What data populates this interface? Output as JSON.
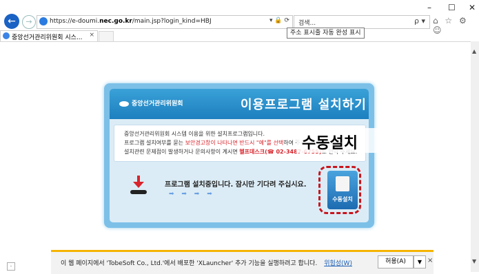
{
  "window": {
    "minimize_icon": "minimize-icon",
    "maximize_icon": "maximize-icon",
    "close_icon": "close-icon",
    "minimize": "–",
    "maximize": "☐",
    "close": "✕"
  },
  "nav": {
    "back": "←",
    "forward": "→"
  },
  "address_bar": {
    "url_prefix": "https://e-doumi.",
    "url_domain": "nec.go.kr",
    "url_suffix": "/main.jsp?login_kind=HBJ",
    "tools": "▾ 🔒 ⟳"
  },
  "search": {
    "placeholder": "검색...",
    "icon": "ρ ▾"
  },
  "toolbar_icons": "⌂ ☆ ⚙ ☺",
  "tab": {
    "label": "중앙선거관리위원회 시스...",
    "close": "×"
  },
  "tooltip": "주소 표시줄 자동 완성 표시",
  "panel": {
    "logo_text": "중앙선거관리위원회",
    "title": "이용프로그램 설치하기",
    "notices": [
      {
        "text_a": "중앙선거관리위원회 시스템 이용을 위한 설치프로그램입니다.",
        "red": "",
        "text_b": ""
      },
      {
        "text_a": "프로그램 설치여부를 묻는 ",
        "red": "보안경고창이 나타나면 반드시 \"예\"를 선택",
        "text_b": "하여 주시기 바랍니다."
      },
      {
        "text_a": "설치관련 문제점이 발생하거나 문의사항이 계시면 ",
        "red": "헬프데스크(☎ 02-3487-6755)",
        "text_b": "로 연락 주세요."
      }
    ],
    "install_message": "프로그램 설치중입니다. 잠시만 기다려 주십시요.",
    "progress_arrows": "➡ ➡ ➡ ➡",
    "manual_button": "수동설치"
  },
  "callout": "수동설치",
  "infobar": {
    "message": "이 웹 페이지에서 'TobeSoft Co., Ltd.'에서 배포한 'XLauncher' 추가 기능을 실행하려고 합니다.",
    "risk_link": "위험성(W)",
    "allow": "허용(A)",
    "dropdown": "▼",
    "close": "×"
  },
  "page_button": "·"
}
